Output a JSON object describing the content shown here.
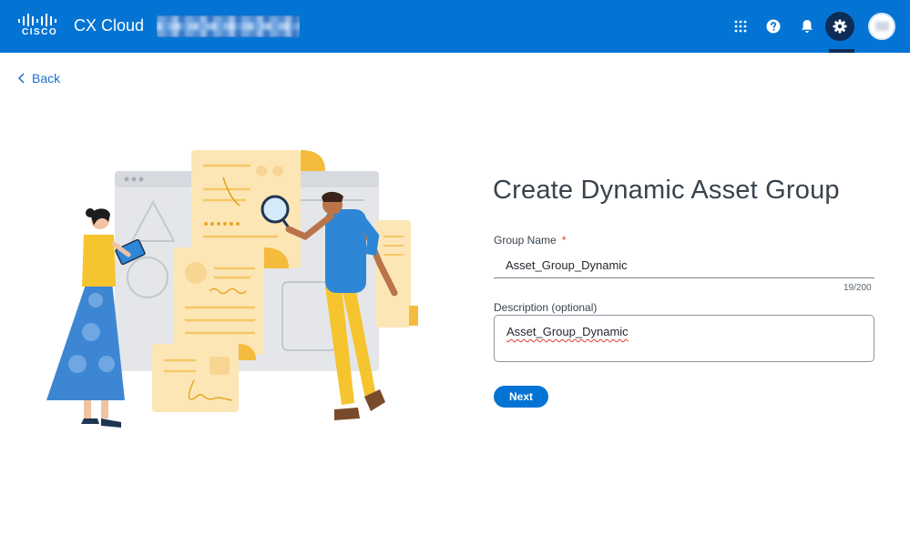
{
  "header": {
    "brand": "CISCO",
    "app_title": "CX Cloud",
    "icons": [
      "apps-grid-icon",
      "help-icon",
      "bell-icon",
      "gear-icon",
      "avatar"
    ],
    "colors": {
      "header_bg": "#0474d4",
      "active_icon_bg": "#0d2d57"
    }
  },
  "nav": {
    "back_label": "Back"
  },
  "form": {
    "title": "Create Dynamic Asset Group",
    "group_name_label": "Group Name",
    "required_marker": "*",
    "group_name_value": "Asset_Group_Dynamic",
    "char_count": "19/200",
    "description_label": "Description (optional)",
    "description_value": "Asset_Group_Dynamic",
    "next_label": "Next"
  }
}
